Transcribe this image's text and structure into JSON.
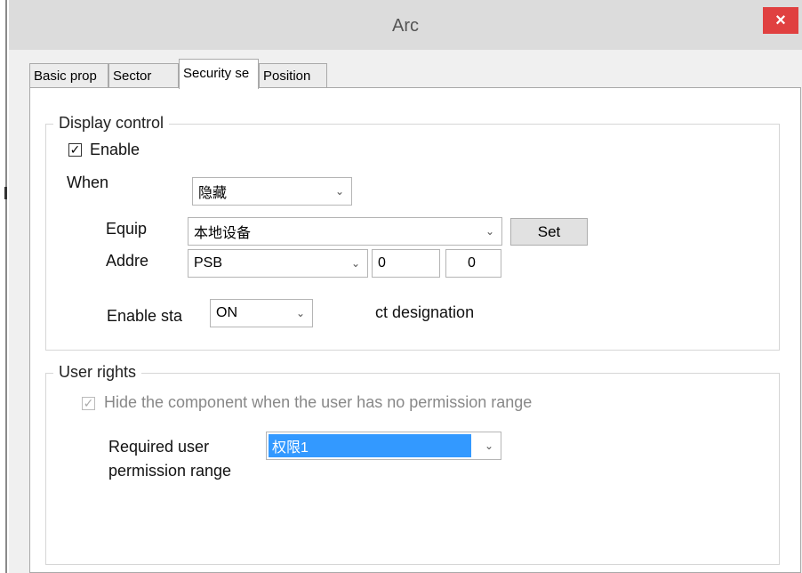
{
  "window": {
    "title": "Arc",
    "close": "×"
  },
  "tabs": [
    {
      "label": "Basic prop"
    },
    {
      "label": "Sector"
    },
    {
      "label": "Security se"
    },
    {
      "label": "Position"
    }
  ],
  "display_control": {
    "title": "Display control",
    "enable_label": "Enable",
    "enable_checked": true,
    "when_label": "When",
    "when_value": "隐藏",
    "equip_label": "Equip",
    "equip_value": "本地设备",
    "set_button": "Set",
    "addr_label": "Addre",
    "addr_type": "PSB",
    "addr_value1": "0",
    "addr_value2": "0",
    "enable_state_label": "Enable sta",
    "enable_state_value": "ON",
    "bit_text": "ct designation"
  },
  "user_rights": {
    "title": "User rights",
    "hide_label": "Hide the component when the user has no permission range",
    "hide_checked": true,
    "required_label_1": "Required user",
    "required_label_2": "permission range",
    "required_value": "权限1"
  },
  "icons": {
    "check": "✓",
    "chevron": "⌄"
  }
}
